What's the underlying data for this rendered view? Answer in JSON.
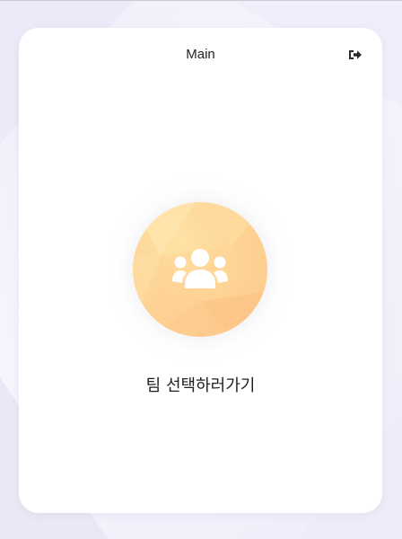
{
  "header": {
    "title": "Main",
    "logout_icon": "sign-out-icon"
  },
  "main": {
    "team_icon": "users-icon",
    "team_label": "팀 선택하러가기"
  },
  "colors": {
    "background": "#f3f2fb",
    "card": "#ffffff",
    "accent_light": "#ffe2a6",
    "accent_dark": "#fcc68a",
    "text": "#222222"
  }
}
